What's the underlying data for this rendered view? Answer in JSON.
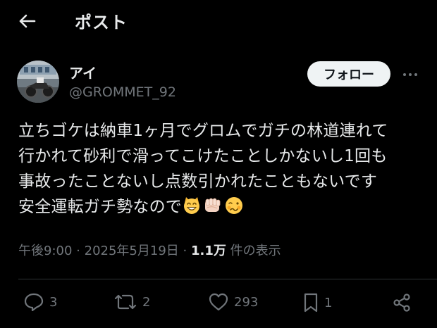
{
  "header": {
    "title": "ポスト",
    "back_icon": "arrow-left-icon"
  },
  "author": {
    "display_name": "アイ",
    "handle": "@GROMMET_92",
    "avatar": "avatar-photo"
  },
  "follow_button": {
    "label": "フォロー"
  },
  "more_button": {
    "icon": "more-horizontal-icon"
  },
  "tweet": {
    "lines": [
      "立ちゴケは納車1ヶ月でグロムでガチの林道連れて",
      "行かれて砂利で滑ってこけたことしかないし1回も",
      "事故ったことないし点数引かれたこともないです",
      "安全運転ガチ勢なので"
    ],
    "emojis": [
      "grinning-cat-emoji",
      "fist-emoji",
      "woozy-face-emoji"
    ]
  },
  "meta": {
    "time": "午後9:00",
    "separator": "·",
    "date": "2025年5月19日",
    "views_count": "1.1万",
    "views_label": "件の表示"
  },
  "actions": {
    "reply": {
      "icon": "reply-icon",
      "count": "3"
    },
    "repost": {
      "icon": "repost-icon",
      "count": "2"
    },
    "like": {
      "icon": "heart-icon",
      "count": "293"
    },
    "bookmark": {
      "icon": "bookmark-icon",
      "count": "1"
    },
    "share": {
      "icon": "share-icon"
    }
  },
  "colors": {
    "background": "#000000",
    "text_primary": "#e7e9ea",
    "text_secondary": "#71767b",
    "divider": "#2f3336",
    "follow_button_bg": "#eff3f4"
  }
}
